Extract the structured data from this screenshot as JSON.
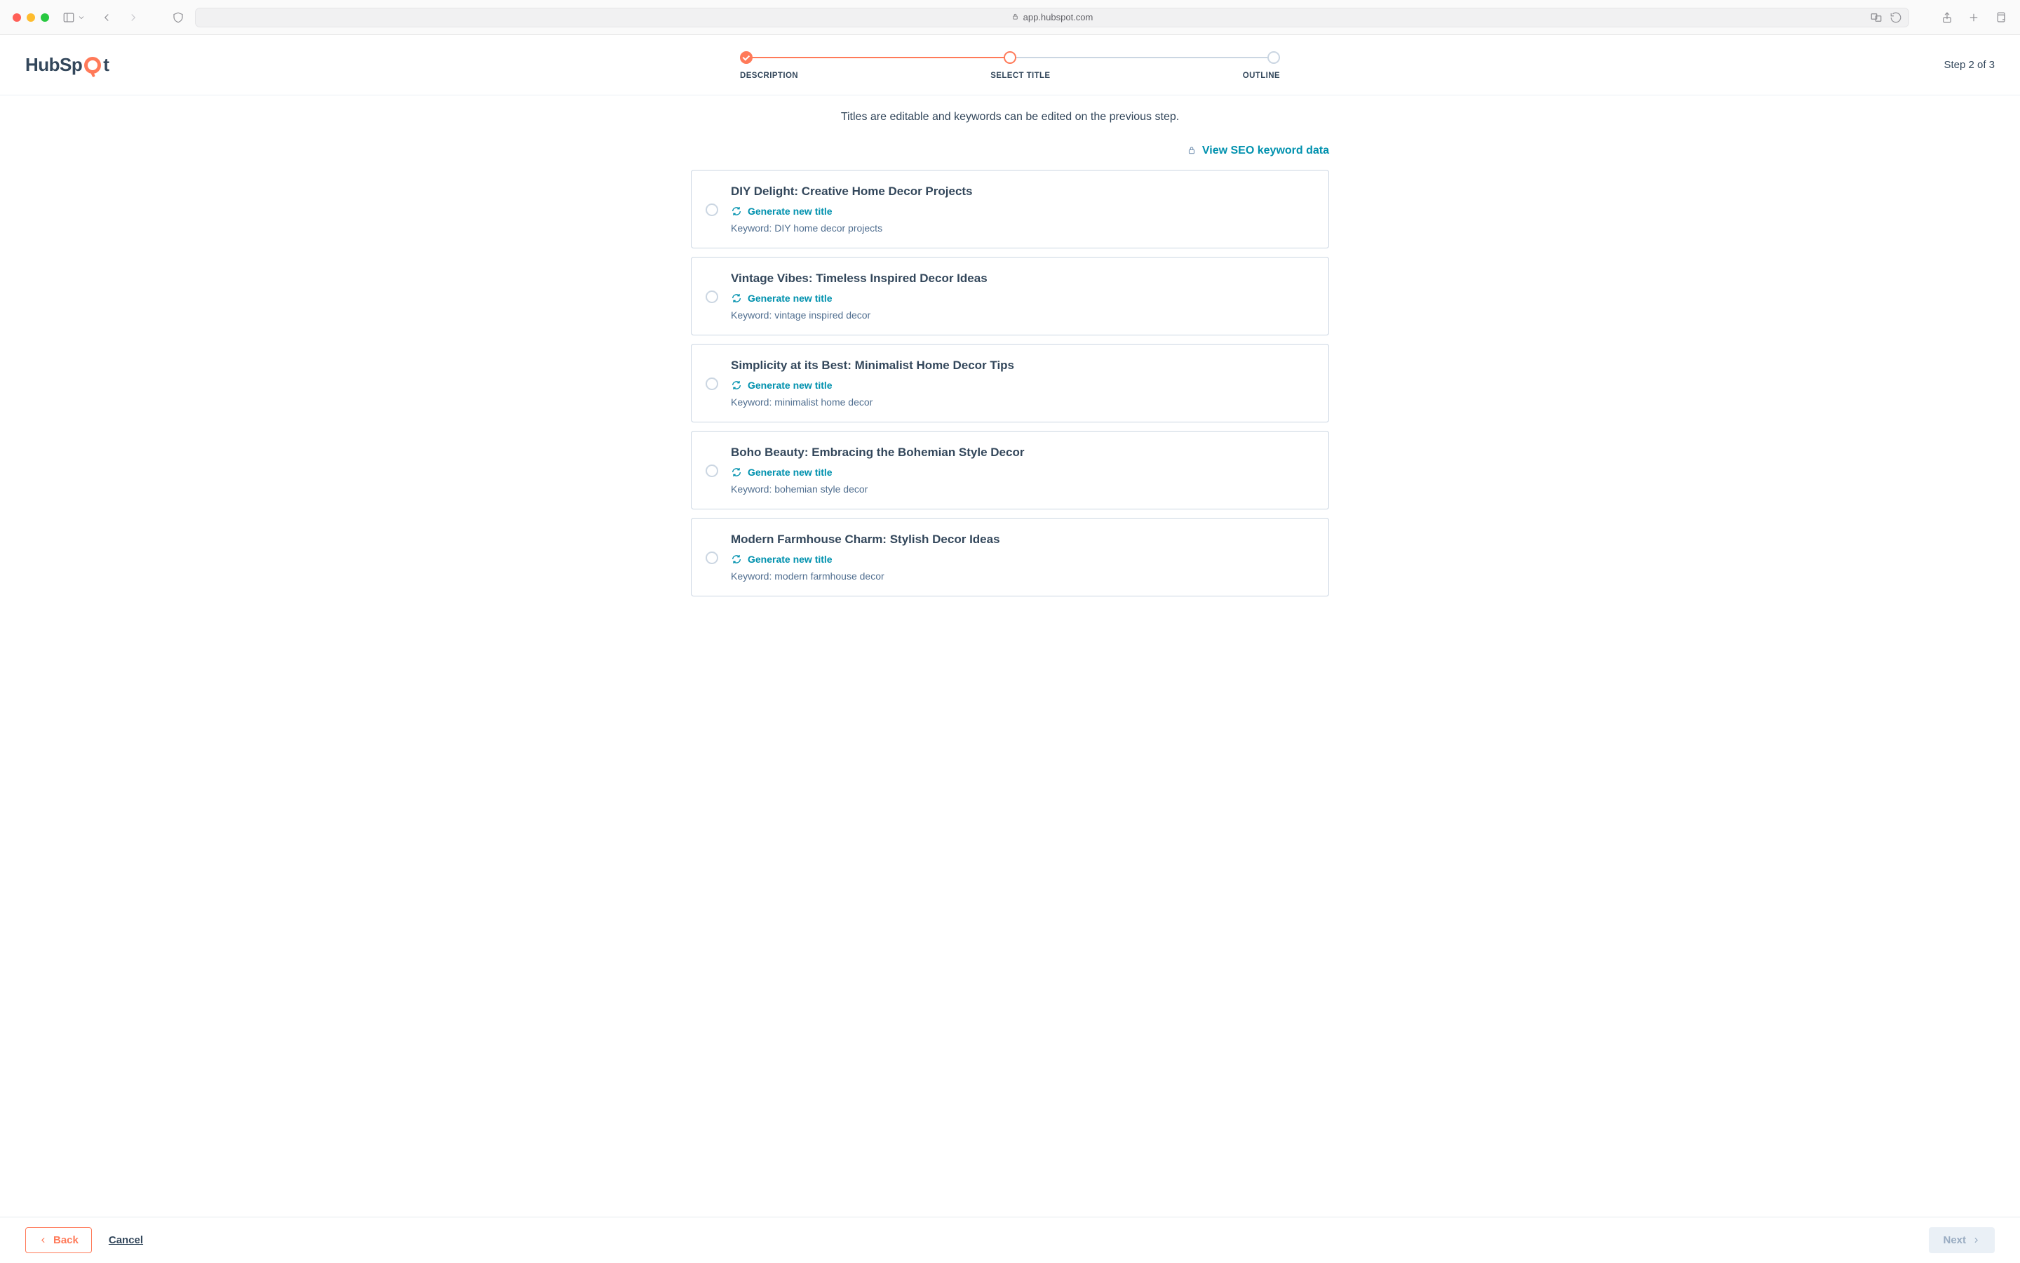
{
  "browser": {
    "url": "app.hubspot.com"
  },
  "logo": {
    "prefix": "HubSp",
    "suffix": "t"
  },
  "stepper": {
    "labels": [
      "DESCRIPTION",
      "SELECT TITLE",
      "OUTLINE"
    ],
    "counter": "Step 2 of 3"
  },
  "subtitle": "Titles are editable and keywords can be edited on the previous step.",
  "seo_link": "View SEO keyword data",
  "generate_label": "Generate new title",
  "keyword_prefix": "Keyword: ",
  "titles": [
    {
      "title": "DIY Delight: Creative Home Decor Projects",
      "keyword": "DIY home decor projects"
    },
    {
      "title": "Vintage Vibes: Timeless Inspired Decor Ideas",
      "keyword": "vintage inspired decor"
    },
    {
      "title": "Simplicity at its Best: Minimalist Home Decor Tips",
      "keyword": "minimalist home decor"
    },
    {
      "title": "Boho Beauty: Embracing the Bohemian Style Decor",
      "keyword": "bohemian style decor"
    },
    {
      "title": "Modern Farmhouse Charm: Stylish Decor Ideas",
      "keyword": "modern farmhouse decor"
    }
  ],
  "footer": {
    "back": "Back",
    "cancel": "Cancel",
    "next": "Next"
  }
}
